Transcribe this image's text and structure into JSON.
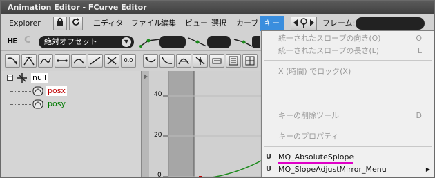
{
  "window": {
    "title": "Animation Editor - FCurve Editor"
  },
  "menubar": {
    "explorer_label": "Explorer",
    "editor_label": "エディタ",
    "menus": [
      "ファイル",
      "編集",
      "ビュー",
      "選択",
      "カーブ",
      "キー"
    ],
    "frame_label": "フレーム:"
  },
  "toolbar2": {
    "he_label": "HE",
    "offset_select_value": "絶対オフセット"
  },
  "toolbar3": {
    "num_label": "0.0"
  },
  "tree": {
    "root_label": "null",
    "children": [
      {
        "label": "posx",
        "color": "#c00000"
      },
      {
        "label": "posy",
        "color": "#007a00"
      }
    ]
  },
  "graph": {
    "y_ticks": [
      "40",
      "20",
      "0"
    ]
  },
  "key_menu": {
    "items": [
      {
        "label": "統一されたスロープの向き(O)",
        "shortcut": "O",
        "enabled": false
      },
      {
        "label": "統一されたスロープの長さ(L)",
        "shortcut": "L",
        "enabled": false
      },
      {
        "label": "X (時間) でロック(X)",
        "shortcut": "",
        "enabled": false
      },
      {
        "label": "キーの削除ツール",
        "shortcut": "D",
        "enabled": false
      },
      {
        "label": "キーのプロパティ",
        "shortcut": "",
        "enabled": false
      },
      {
        "label": "MQ_AbsoluteSplope",
        "shortcut": "",
        "enabled": true,
        "prefix": "U"
      },
      {
        "label": "MQ_SlopeAdjustMirror_Menu",
        "shortcut": "",
        "enabled": true,
        "prefix": "U",
        "submenu": true
      }
    ],
    "highlight_color": "#e000c8"
  }
}
